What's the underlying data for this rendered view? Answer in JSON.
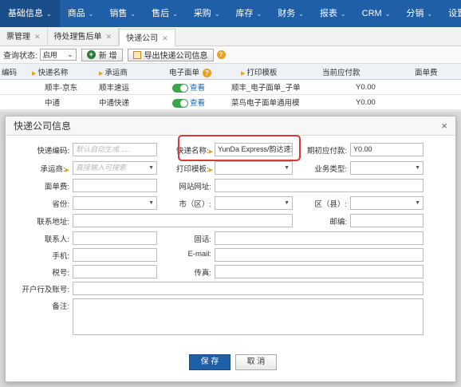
{
  "nav": {
    "items": [
      {
        "label": "基础信息",
        "chev": "⌄"
      },
      {
        "label": "商品",
        "chev": "⌄"
      },
      {
        "label": "销售",
        "chev": "⌄"
      },
      {
        "label": "售后",
        "chev": "⌄"
      },
      {
        "label": "采购",
        "chev": "⌄"
      },
      {
        "label": "库存",
        "chev": "⌄"
      },
      {
        "label": "财务",
        "chev": "⌄"
      },
      {
        "label": "报表",
        "chev": "⌄"
      },
      {
        "label": "CRM",
        "chev": "⌄"
      },
      {
        "label": "分销",
        "chev": "⌄"
      },
      {
        "label": "设置",
        "chev": ""
      }
    ]
  },
  "tabs": [
    {
      "label": "票管理",
      "close": "✕"
    },
    {
      "label": "待处理售后单",
      "close": "✕"
    },
    {
      "label": "快递公司",
      "close": "✕"
    }
  ],
  "toolbar": {
    "status_label": "查询状态:",
    "status_value": "启用",
    "add_label": "新 增",
    "export_label": "导出快递公司信息",
    "help_glyph": "?"
  },
  "grid": {
    "headers": [
      "编码",
      "快递名称",
      "承运商",
      "电子面单",
      "打印模板",
      "当前应付款",
      "面单费"
    ],
    "rows": [
      {
        "name": "顺丰-京东",
        "carrier": "顺丰速运",
        "view": "查看",
        "template": "顺丰_电子面单_子单",
        "payable": "Y0.00"
      },
      {
        "name": "中通",
        "carrier": "中通快递",
        "view": "查看",
        "template": "菜鸟电子面单通用模",
        "payable": "Y0.00"
      }
    ]
  },
  "modal": {
    "title": "快递公司信息",
    "close": "×",
    "fields": {
      "code_label": "快递编码:",
      "code_placeholder": "默认自动生成......",
      "name_label": "快递名称:",
      "name_value": "YunDa Express/韵达速递",
      "init_pay_label": "期初应付款:",
      "init_pay_value": "Y0.00",
      "carrier_label": "承运商:",
      "carrier_placeholder": "直接输入可搜索",
      "template_label": "打印模板:",
      "biz_type_label": "业务类型:",
      "fee_label": "面单费:",
      "website_label": "网站网址:",
      "province_label": "省份:",
      "city_label": "市（区）:",
      "county_label": "区（县）:",
      "address_label": "联系地址:",
      "zip_label": "邮编:",
      "contact_label": "联系人:",
      "phone_label": "固话:",
      "mobile_label": "手机:",
      "email_label": "E-mail:",
      "tax_label": "税号:",
      "fax_label": "传真:",
      "bank_label": "开户行及账号:",
      "remark_label": "备注:"
    },
    "save_label": "保 存",
    "cancel_label": "取 消"
  },
  "colors": {
    "nav_bg": "#1f5fa8",
    "primary": "#1f5fa8",
    "highlight": "#d9363e",
    "toggle_on": "#3aa54a"
  }
}
